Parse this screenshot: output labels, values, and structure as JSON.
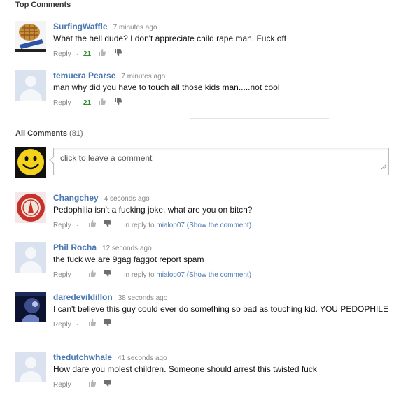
{
  "top_comments": {
    "heading": "Top Comments",
    "items": [
      {
        "author": "SurfingWaffle",
        "time": "7 minutes ago",
        "text": "What the hell dude? I don't appreciate child rape man. Fuck off",
        "reply": "Reply",
        "likes": "21",
        "avatar": "waffle-image"
      },
      {
        "author": "temuera Pearse",
        "time": "7 minutes ago",
        "text": "man why did you have to touch all those kids man.....not cool",
        "reply": "Reply",
        "likes": "21",
        "avatar": "default-silhouette"
      }
    ]
  },
  "all_comments": {
    "heading": "All Comments",
    "count": "(81)",
    "compose_placeholder": "click to leave a comment",
    "items": [
      {
        "author": "Changchey",
        "time": "4 seconds ago",
        "text": "Pedophilia isn't a fucking joke, what are you on bitch?",
        "reply": "Reply",
        "in_reply_prefix": "in reply to",
        "in_reply_user": "mialop07",
        "show_comment": "(Show the comment)",
        "avatar": "red-emblem"
      },
      {
        "author": "Phil Rocha",
        "time": "12 seconds ago",
        "text": "the fuck we are 9gag faggot report spam",
        "reply": "Reply",
        "in_reply_prefix": "in reply to",
        "in_reply_user": "mialop07",
        "show_comment": "(Show the comment)",
        "avatar": "default-silhouette"
      },
      {
        "author": "daredevildillon",
        "time": "38 seconds ago",
        "text": "I can't believe this guy could ever do something so bad as touching kid. YOU PEDOPHILE",
        "reply": "Reply",
        "avatar": "dark-blue-photo"
      },
      {
        "author": "thedutchwhale",
        "time": "41 seconds ago",
        "text": "How dare you molest children. Someone should arrest this twisted fuck",
        "reply": "Reply",
        "avatar": "default-silhouette"
      }
    ]
  },
  "icons": {
    "thumb_up": "thumbs-up-icon",
    "thumb_down": "thumbs-down-icon",
    "compose_avatar": "smiley-face-icon",
    "resize_grip": "resize-grip-icon"
  },
  "colors": {
    "author_link": "#4a78b3",
    "likes": "#2f8a2f",
    "meta": "#888888"
  }
}
